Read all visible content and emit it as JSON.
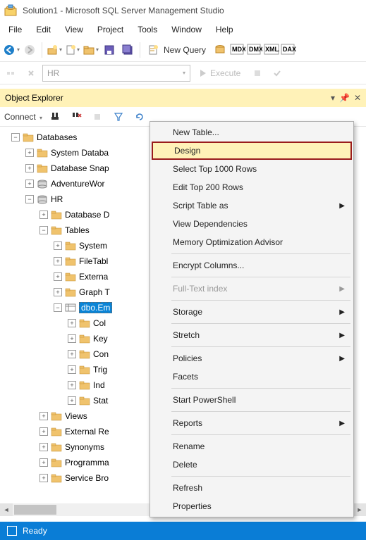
{
  "window": {
    "title": "Solution1 - Microsoft SQL Server Management Studio"
  },
  "menu": {
    "items": [
      "File",
      "Edit",
      "View",
      "Project",
      "Tools",
      "Window",
      "Help"
    ]
  },
  "toolbar": {
    "new_query": "New Query",
    "badges": [
      "MDX",
      "DMX",
      "XMLA",
      "DAX"
    ]
  },
  "toolbar2": {
    "combo_value": "HR",
    "execute": "Execute"
  },
  "explorer": {
    "title": "Object Explorer",
    "connect": "Connect",
    "tree": {
      "databases": "Databases",
      "nodes": [
        "System Databa",
        "Database Snap",
        "AdventureWor",
        "HR"
      ],
      "hr_children": [
        "Database D",
        "Tables"
      ],
      "tables_children": [
        "System",
        "FileTabl",
        "Externa",
        "Graph T",
        "dbo.Em"
      ],
      "table_children": [
        "Col",
        "Key",
        "Con",
        "Trig",
        "Ind",
        "Stat"
      ],
      "after_tables": [
        "Views",
        "External Re",
        "Synonyms",
        "Programma",
        "Service Bro"
      ]
    }
  },
  "context_menu": {
    "items": [
      {
        "label": "New Table...",
        "enabled": true
      },
      {
        "label": "Design",
        "enabled": true,
        "highlight": true
      },
      {
        "label": "Select Top 1000 Rows",
        "enabled": true
      },
      {
        "label": "Edit Top 200 Rows",
        "enabled": true
      },
      {
        "label": "Script Table as",
        "enabled": true,
        "sub": true
      },
      {
        "label": "View Dependencies",
        "enabled": true
      },
      {
        "label": "Memory Optimization Advisor",
        "enabled": true
      },
      {
        "sep": true
      },
      {
        "label": "Encrypt Columns...",
        "enabled": true
      },
      {
        "sep": true
      },
      {
        "label": "Full-Text index",
        "enabled": false,
        "sub": true
      },
      {
        "sep": true
      },
      {
        "label": "Storage",
        "enabled": true,
        "sub": true
      },
      {
        "sep": true
      },
      {
        "label": "Stretch",
        "enabled": true,
        "sub": true
      },
      {
        "sep": true
      },
      {
        "label": "Policies",
        "enabled": true,
        "sub": true
      },
      {
        "label": "Facets",
        "enabled": true
      },
      {
        "sep": true
      },
      {
        "label": "Start PowerShell",
        "enabled": true
      },
      {
        "sep": true
      },
      {
        "label": "Reports",
        "enabled": true,
        "sub": true
      },
      {
        "sep": true
      },
      {
        "label": "Rename",
        "enabled": true
      },
      {
        "label": "Delete",
        "enabled": true
      },
      {
        "sep": true
      },
      {
        "label": "Refresh",
        "enabled": true
      },
      {
        "label": "Properties",
        "enabled": true
      }
    ]
  },
  "status": {
    "text": "Ready"
  }
}
